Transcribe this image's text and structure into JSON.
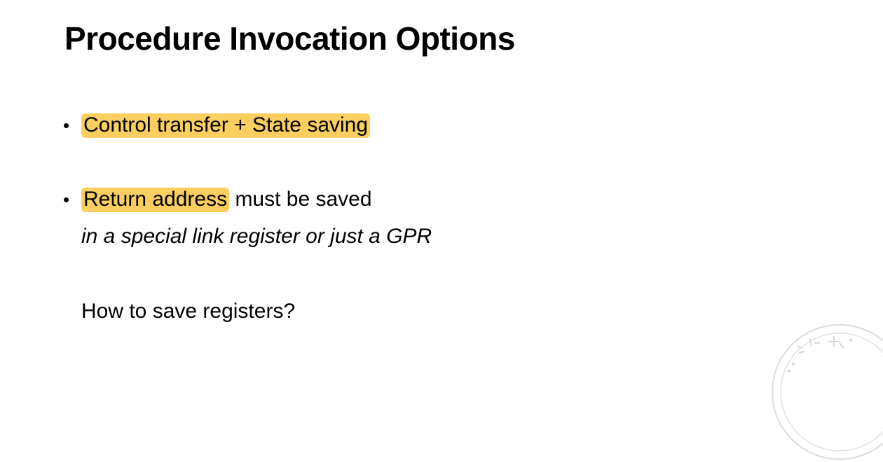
{
  "slide": {
    "title": "Procedure Invocation Options",
    "bullets": [
      {
        "highlight": "Control transfer + State saving",
        "rest": ""
      },
      {
        "highlight": "Return address",
        "rest": " must be saved",
        "subline": "in a special link register or just a GPR"
      }
    ],
    "question": "How to save registers?",
    "bullet_glyph": "•",
    "highlight_color": "#fbcf5f"
  },
  "watermark": {
    "icon": "university-seal-icon"
  }
}
